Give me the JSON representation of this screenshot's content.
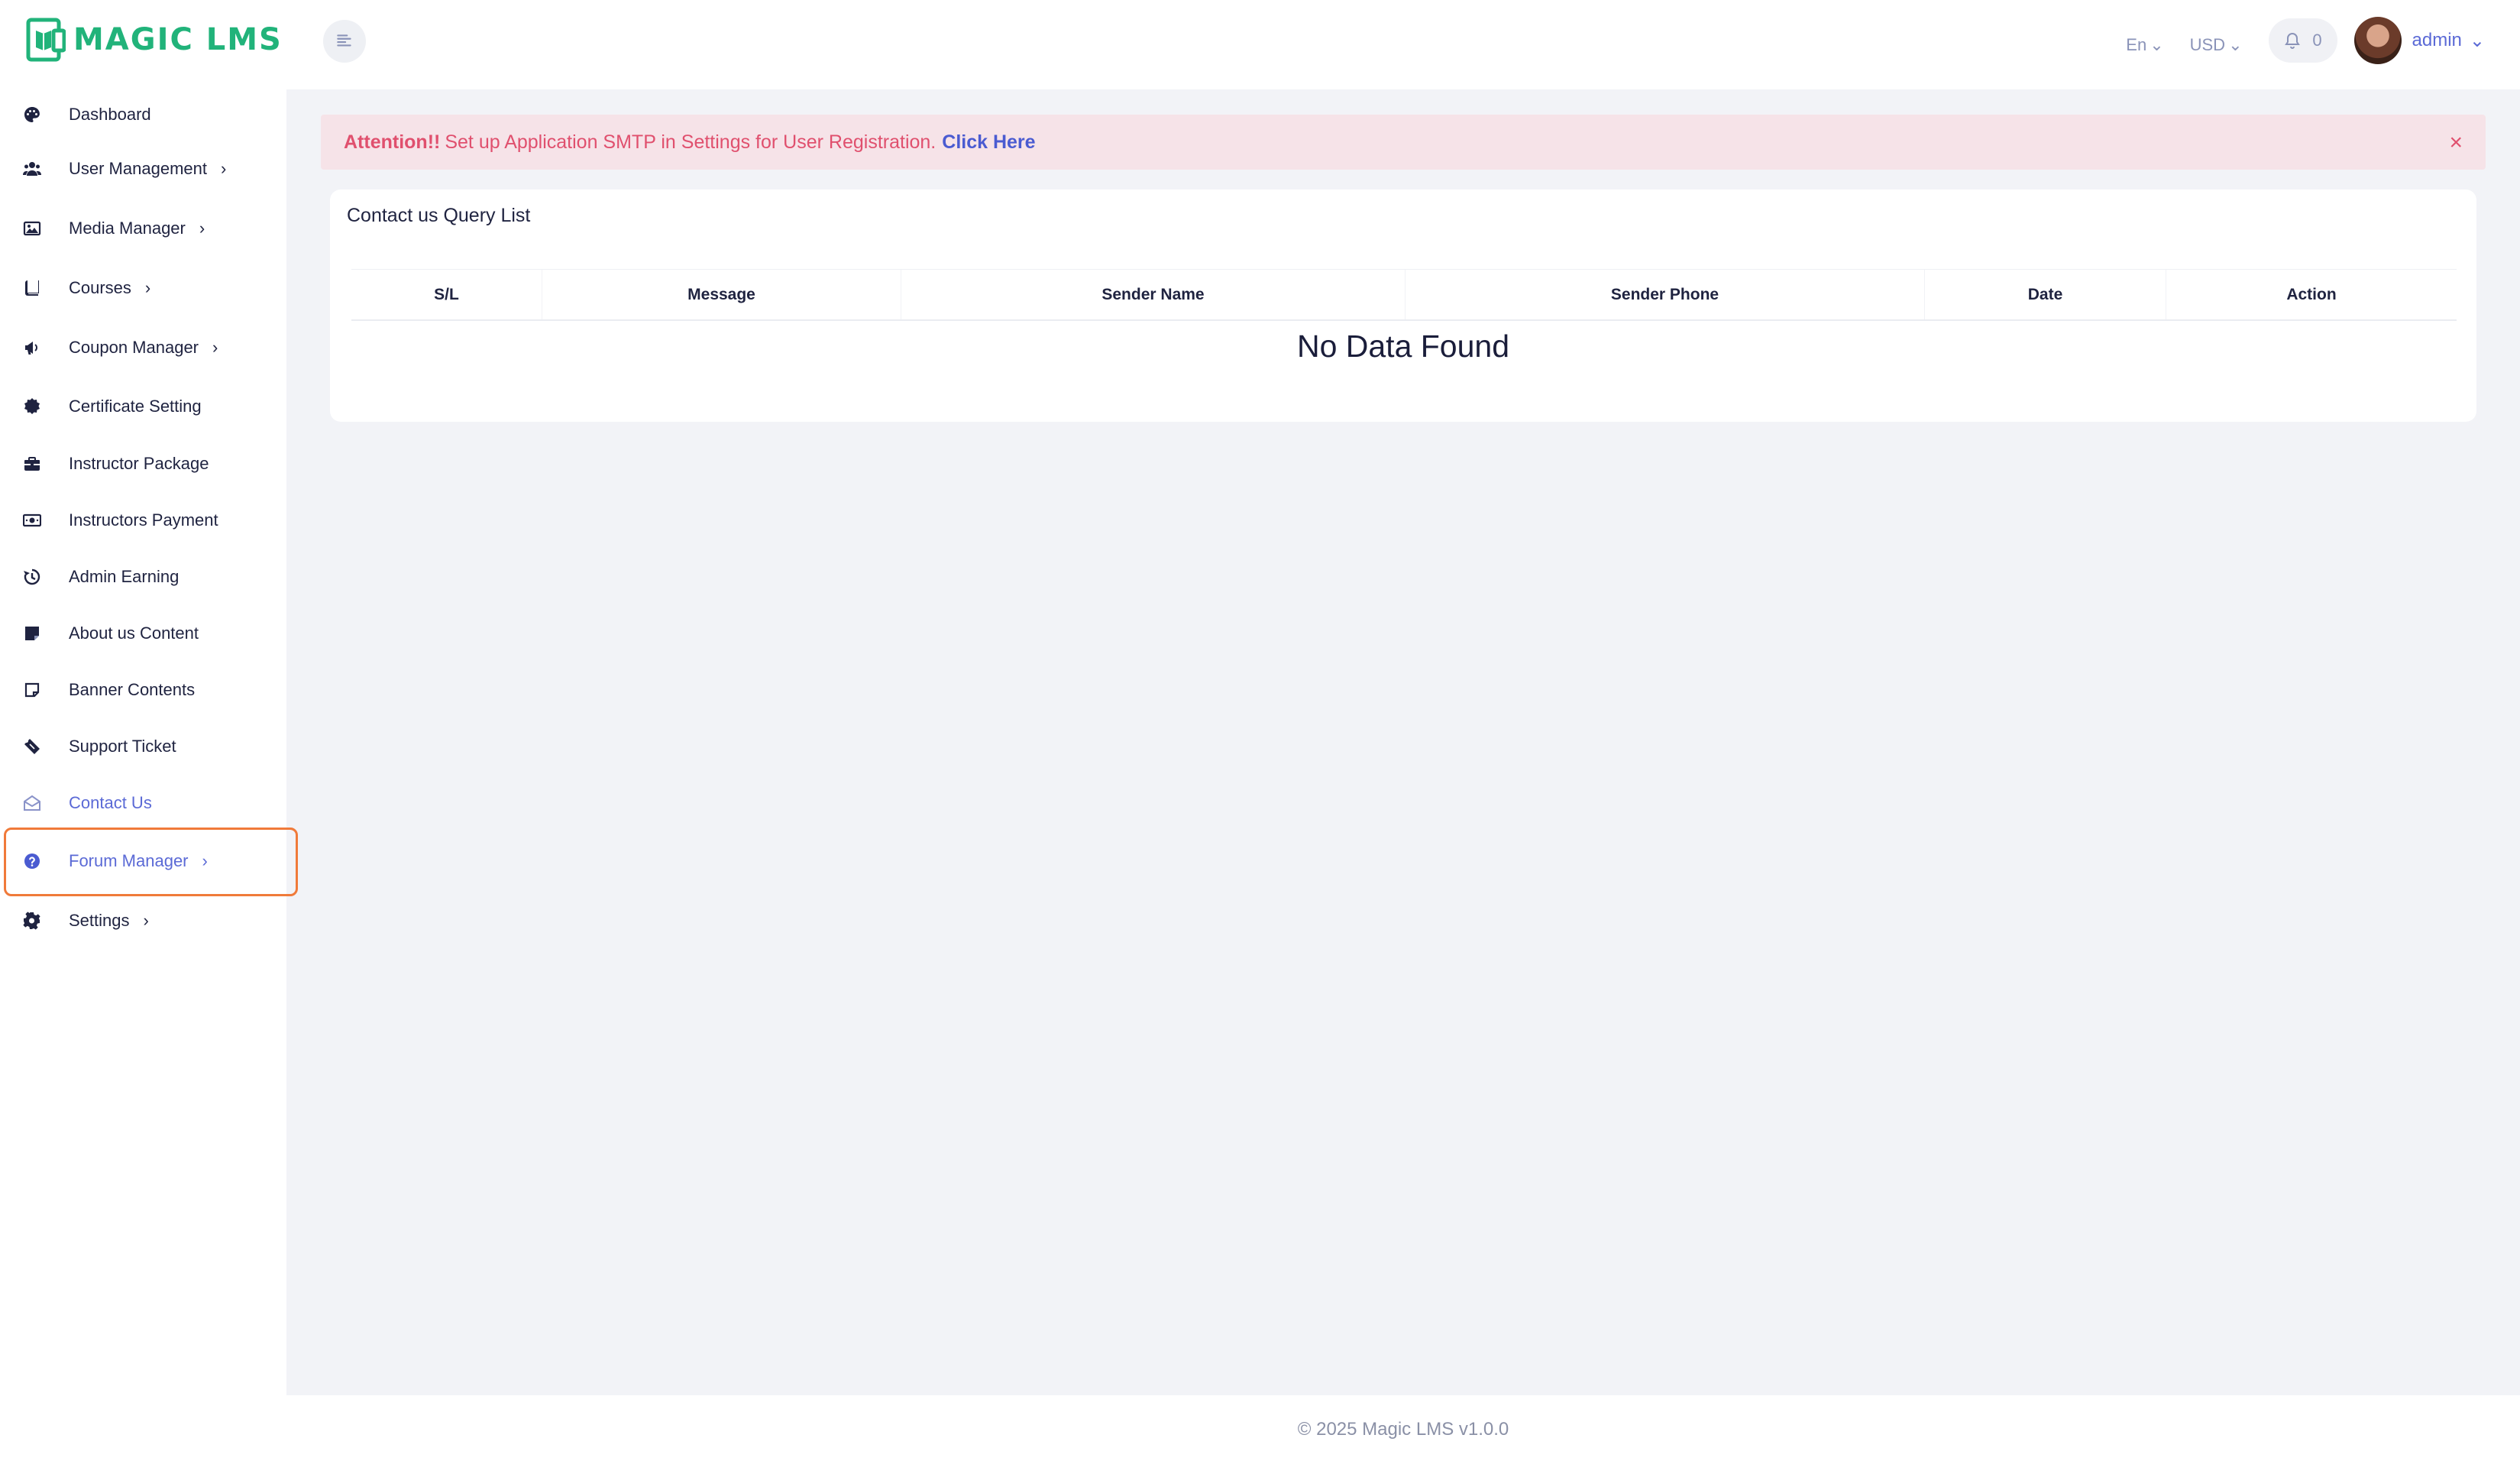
{
  "brand": {
    "name": "MAGIC LMS",
    "color": "#21b37a"
  },
  "sidebar": {
    "items": [
      {
        "label": "Dashboard",
        "icon": "palette-icon",
        "has_chevron": false
      },
      {
        "label": "User Management",
        "icon": "users-icon",
        "has_chevron": true
      },
      {
        "label": "Media Manager",
        "icon": "image-icon",
        "has_chevron": true
      },
      {
        "label": "Courses",
        "icon": "book-icon",
        "has_chevron": true
      },
      {
        "label": "Coupon Manager",
        "icon": "megaphone-icon",
        "has_chevron": true
      },
      {
        "label": "Certificate Setting",
        "icon": "certificate-icon",
        "has_chevron": false
      },
      {
        "label": "Instructor Package",
        "icon": "briefcase-icon",
        "has_chevron": false
      },
      {
        "label": "Instructors Payment",
        "icon": "money-bill-icon",
        "has_chevron": false
      },
      {
        "label": "Admin Earning",
        "icon": "history-icon",
        "has_chevron": false
      },
      {
        "label": "About us Content",
        "icon": "sticky-note-icon",
        "has_chevron": false
      },
      {
        "label": "Banner Contents",
        "icon": "note-icon",
        "has_chevron": false
      },
      {
        "label": "Support Ticket",
        "icon": "ticket-icon",
        "has_chevron": false
      },
      {
        "label": "Contact Us",
        "icon": "envelope-open-icon",
        "has_chevron": false,
        "active": true
      },
      {
        "label": "Forum Manager",
        "icon": "question-circle-icon",
        "has_chevron": true,
        "highlighted": true
      },
      {
        "label": "Settings",
        "icon": "gear-icon",
        "has_chevron": true
      }
    ]
  },
  "header": {
    "language": "En",
    "currency": "USD",
    "notification_count": "0",
    "user_name": "admin"
  },
  "alert": {
    "prefix": "Attention!!",
    "message": "Set up Application SMTP in Settings for User Registration.",
    "link": "Click Here",
    "close": "×"
  },
  "card": {
    "title": "Contact us Query List",
    "columns": [
      "S/L",
      "Message",
      "Sender Name",
      "Sender Phone",
      "Date",
      "Action"
    ],
    "empty_text": "No Data Found"
  },
  "footer": {
    "text": "© 2025 Magic LMS v1.0.0"
  },
  "colors": {
    "accent": "#5b6ad6",
    "alert_text": "#e0506e",
    "alert_bg": "#f6e3e8",
    "highlight_border": "#f07a3a"
  }
}
